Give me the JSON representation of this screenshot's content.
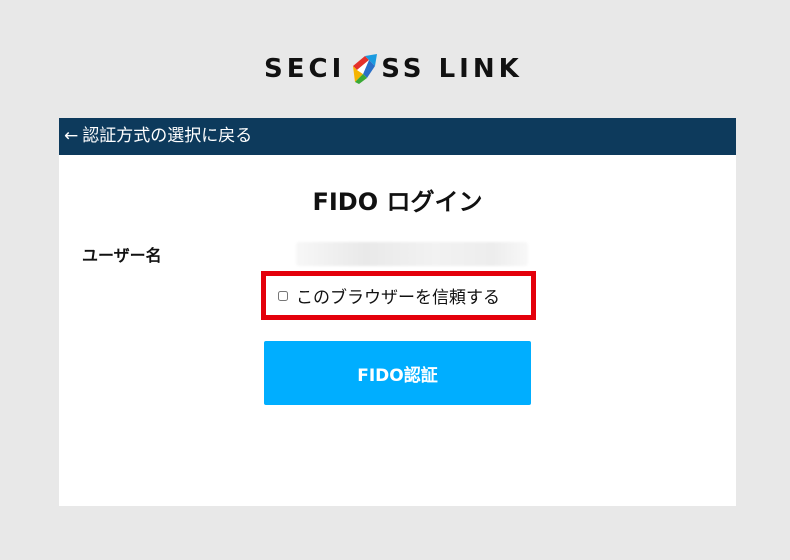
{
  "logo": {
    "text_before": "SECI",
    "text_after": "SS LINK"
  },
  "nav": {
    "back_arrow": "←",
    "back_label": "認証方式の選択に戻る"
  },
  "main": {
    "title": "FIDO ログイン",
    "username_label": "ユーザー名",
    "trust_browser_label": "このブラウザーを信頼する",
    "fido_button_label": "FIDO認証"
  },
  "colors": {
    "topbar": "#0d3a5c",
    "button": "#00aeff",
    "highlight": "#e4000b"
  }
}
